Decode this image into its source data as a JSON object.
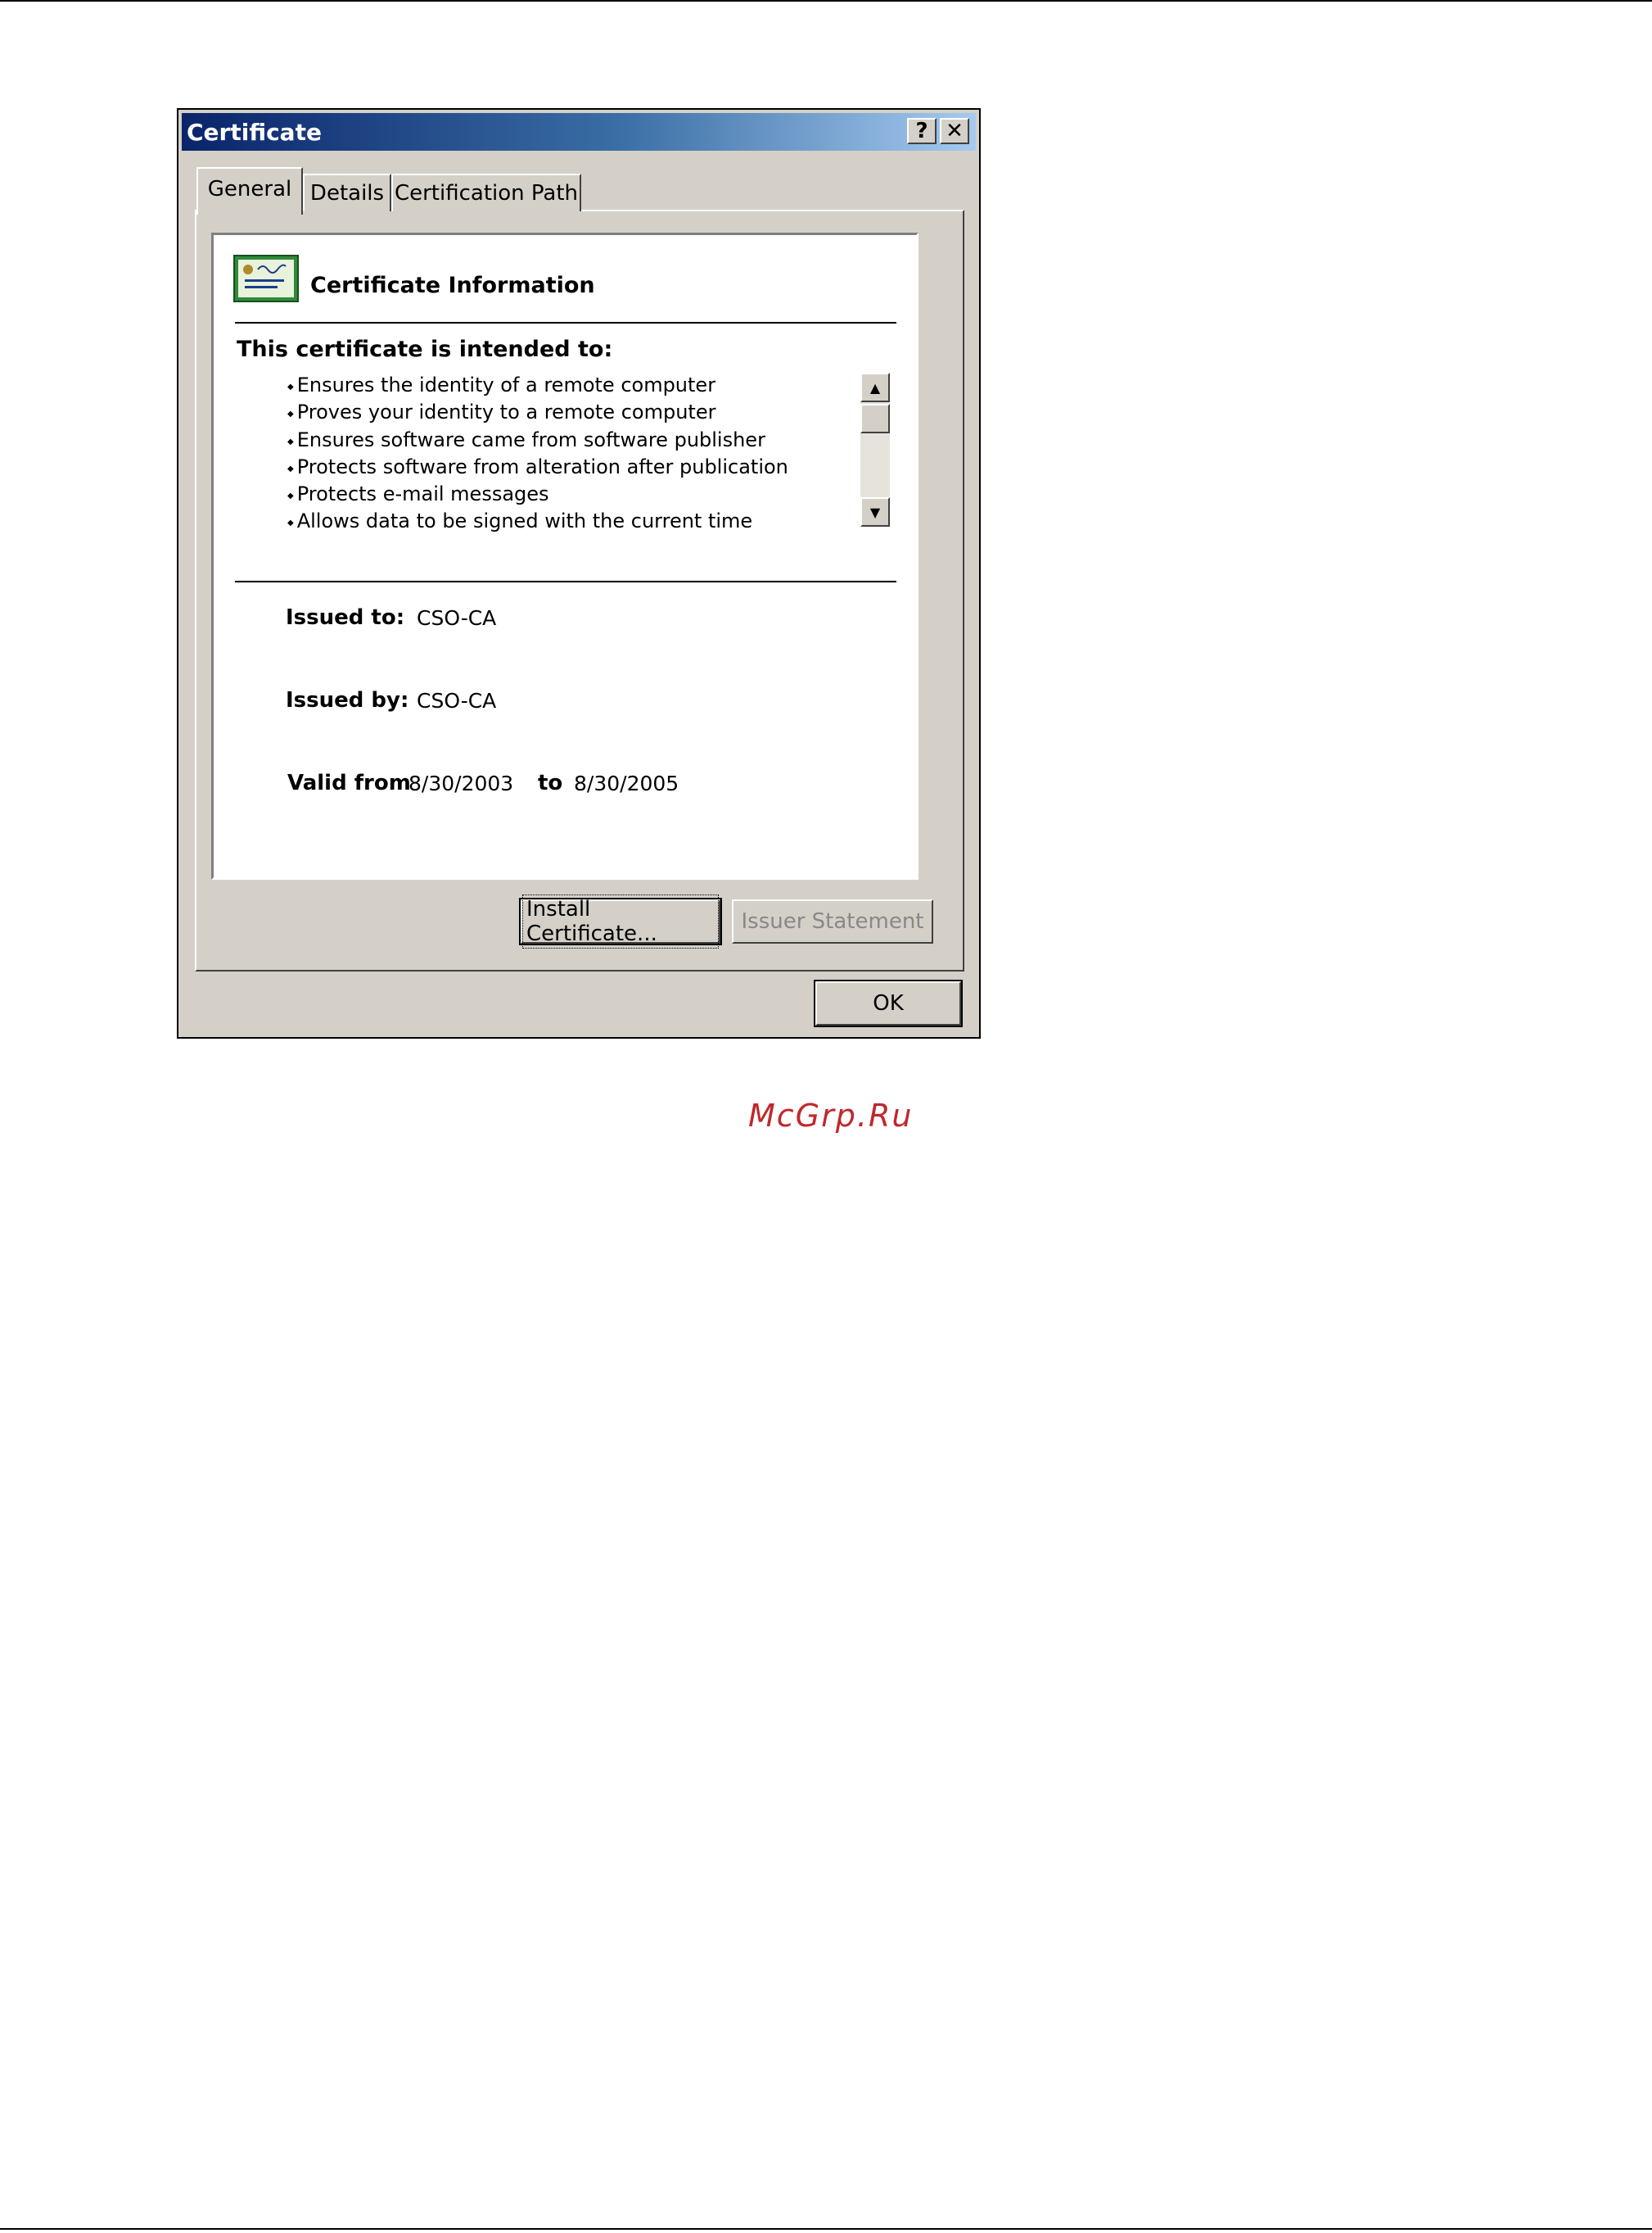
{
  "dialog": {
    "title": "Certificate",
    "help_button": "?",
    "close_button": "✕",
    "tabs": [
      {
        "label": "General",
        "active": true
      },
      {
        "label": "Details",
        "active": false
      },
      {
        "label": "Certification Path",
        "active": false
      }
    ],
    "info": {
      "heading": "Certificate Information",
      "intended_heading": "This certificate is intended to:",
      "purposes": [
        "Ensures the identity of a remote computer",
        "Proves your identity to a remote computer",
        "Ensures software came from software publisher",
        "Protects software from alteration after publication",
        "Protects e-mail messages",
        "Allows data to be signed with the current time"
      ],
      "issued_to_label": "Issued to:",
      "issued_to": "CSO-CA",
      "issued_by_label": "Issued by:",
      "issued_by": "CSO-CA",
      "valid_from_label": "Valid from",
      "valid_from": "8/30/2003",
      "to_label": "to",
      "valid_to": "8/30/2005"
    },
    "buttons": {
      "install": "Install Certificate...",
      "issuer": "Issuer Statement",
      "ok": "OK"
    }
  },
  "watermark": "McGrp.Ru",
  "colors": {
    "title_gradient_start": "#0a246a",
    "title_gradient_end": "#a6caf0",
    "face": "#d4d0c8",
    "watermark": "#c0282d"
  }
}
